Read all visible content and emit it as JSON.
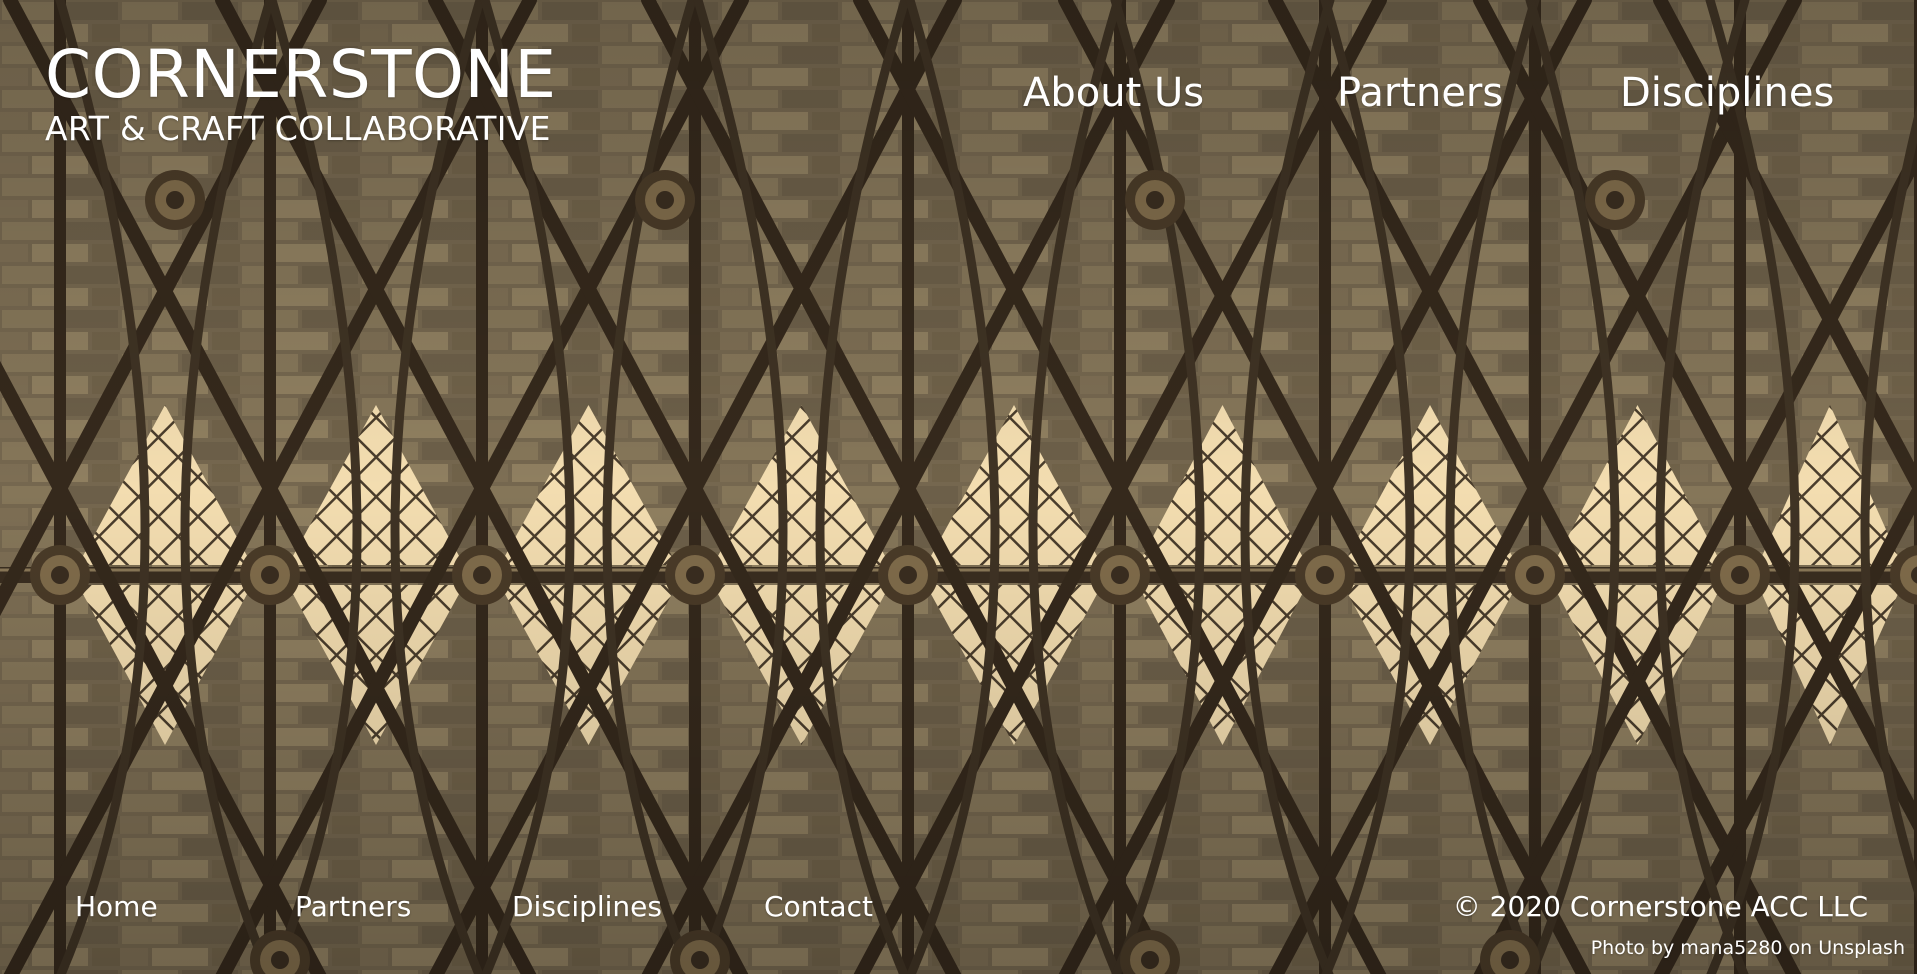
{
  "logo": {
    "title": "CORNERSTONE",
    "subtitle": "ART & CRAFT COLLABORATIVE"
  },
  "top_nav": {
    "about": "About Us",
    "partners": "Partners",
    "disciplines": "Disciplines"
  },
  "footer_nav": {
    "home": "Home",
    "partners": "Partners",
    "disciplines": "Disciplines",
    "contact": "Contact"
  },
  "footer": {
    "copyright": "© 2020 Cornerstone ACC LLC",
    "photo_credit": "Photo by mana5280 on Unsplash"
  },
  "colors": {
    "stone": "#6f6250",
    "light": "#f0d9a8",
    "rib": "#3a2f22",
    "text": "#ffffff"
  }
}
